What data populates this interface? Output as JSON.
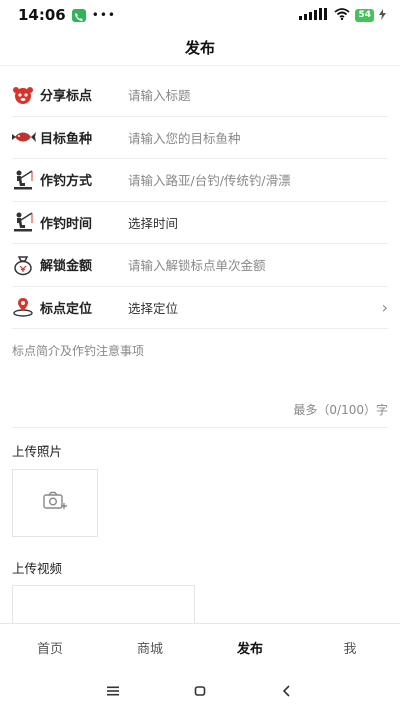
{
  "status": {
    "time": "14:06",
    "dots": "•••",
    "battery": "54"
  },
  "header": {
    "title": "发布"
  },
  "form": {
    "rows": [
      {
        "label": "分享标点",
        "value": "请输入标题",
        "icon": "fish-face-icon"
      },
      {
        "label": "目标鱼种",
        "value": "请输入您的目标鱼种",
        "icon": "fish-icon"
      },
      {
        "label": "作钓方式",
        "value": "请输入路亚/台钓/传统钓/滑漂",
        "icon": "fisherman-icon"
      },
      {
        "label": "作钓时间",
        "value": "选择时间",
        "icon": "fisherman-icon"
      },
      {
        "label": "解锁金额",
        "value": "请输入解锁标点单次金额",
        "icon": "money-bag-icon"
      },
      {
        "label": "标点定位",
        "value": "选择定位",
        "icon": "location-pin-icon",
        "arrow": "›"
      }
    ]
  },
  "description": {
    "placeholder": "标点简介及作钓注意事项",
    "counter": "最多（0/100）字"
  },
  "upload": {
    "photo_label": "上传照片",
    "video_label": "上传视频"
  },
  "tabbar": {
    "items": [
      "首页",
      "商城",
      "发布",
      "我"
    ],
    "active": 2
  },
  "colors": {
    "accent_red": "#d9342b",
    "divider": "#ededed"
  }
}
